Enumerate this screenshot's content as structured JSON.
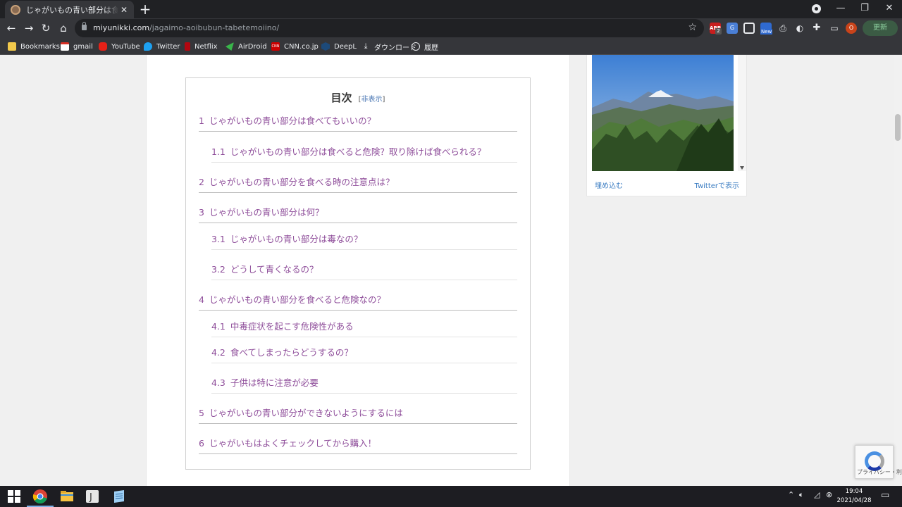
{
  "browser": {
    "tab_title": "じゃがいもの青い部分は食べてもいいの？",
    "url_host": "miyunikki.com",
    "url_path": "/jagaimo-aoibubun-tabetemoiino/",
    "update_label": "更新",
    "profile_initial": "O",
    "abp_badge": "2",
    "ext_new_badge": "New"
  },
  "bookmarks": [
    {
      "label": "Bookmarks",
      "icon": "folder-icon"
    },
    {
      "label": "gmail",
      "icon": "gmail-icon"
    },
    {
      "label": "YouTube",
      "icon": "youtube-icon"
    },
    {
      "label": "Twitter",
      "icon": "twitter-icon"
    },
    {
      "label": "Netflix",
      "icon": "netflix-icon"
    },
    {
      "label": "AirDroid",
      "icon": "airdroid-icon"
    },
    {
      "label": "CNN.co.jp",
      "icon": "cnn-icon"
    },
    {
      "label": "DeepL",
      "icon": "deepl-icon"
    },
    {
      "label": "ダウンロード",
      "icon": "download-icon"
    },
    {
      "label": "履歴",
      "icon": "history-icon"
    }
  ],
  "toc": {
    "title": "目次",
    "toggle_open": "[",
    "toggle_label": "非表示",
    "toggle_close": "]",
    "items": [
      {
        "num": "1",
        "text": "じゃがいもの青い部分は食べてもいいの？",
        "level": 1
      },
      {
        "num": "1.1",
        "text": "じゃがいもの青い部分は食べると危険？取り除けば食べられる？",
        "level": 2
      },
      {
        "num": "2",
        "text": "じゃがいもの青い部分を食べる時の注意点は？",
        "level": 1
      },
      {
        "num": "3",
        "text": "じゃがいもの青い部分は何？",
        "level": 1
      },
      {
        "num": "3.1",
        "text": "じゃがいもの青い部分は毒なの？",
        "level": 2
      },
      {
        "num": "3.2",
        "text": "どうして青くなるの？",
        "level": 2
      },
      {
        "num": "4",
        "text": "じゃがいもの青い部分を食べると危険なの？",
        "level": 1
      },
      {
        "num": "4.1",
        "text": "中毒症状を起こす危険性がある",
        "level": 2
      },
      {
        "num": "4.2",
        "text": "食べてしまったらどうするの？",
        "level": 2
      },
      {
        "num": "4.3",
        "text": "子供は特に注意が必要",
        "level": 2
      },
      {
        "num": "5",
        "text": "じゃがいもの青い部分ができないようにするには",
        "level": 1
      },
      {
        "num": "6",
        "text": "じゃがいもはよくチェックしてから購入！",
        "level": 1
      }
    ]
  },
  "twitter_embed": {
    "embed_label": "埋め込む",
    "view_label": "Twitterで表示"
  },
  "recaptcha": {
    "text": "プライバシー・利用規約"
  },
  "taskbar": {
    "time": "19:04",
    "date": "2021/04/28"
  },
  "colors": {
    "toc_link": "#8e4d9a",
    "link_blue": "#3a7cc2",
    "update_green": "#8ed1a0"
  }
}
